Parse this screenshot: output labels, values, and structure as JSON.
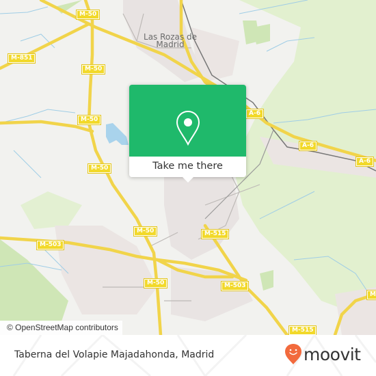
{
  "map": {
    "place_labels": [
      {
        "name": "Las Rozas de Madrid"
      }
    ],
    "road_shields": [
      {
        "label": "M-50"
      },
      {
        "label": "M-851"
      },
      {
        "label": "M-50"
      },
      {
        "label": "M-50"
      },
      {
        "label": "M-50"
      },
      {
        "label": "A-6"
      },
      {
        "label": "A-6"
      },
      {
        "label": "A-6"
      },
      {
        "label": "M-50"
      },
      {
        "label": "M-503"
      },
      {
        "label": "M-515"
      },
      {
        "label": "M-50"
      },
      {
        "label": "M-503"
      },
      {
        "label": "M-515"
      },
      {
        "label": "M"
      }
    ],
    "attribution": "© OpenStreetMap contributors"
  },
  "popup": {
    "icon": "location-pin-icon",
    "action_label": "Take me there",
    "accent_color": "#1fb96b"
  },
  "footer": {
    "place_name": "Taberna del Volapie Majadahonda, Madrid",
    "logo_text": "moovit",
    "logo_color": "#f26a3d"
  }
}
